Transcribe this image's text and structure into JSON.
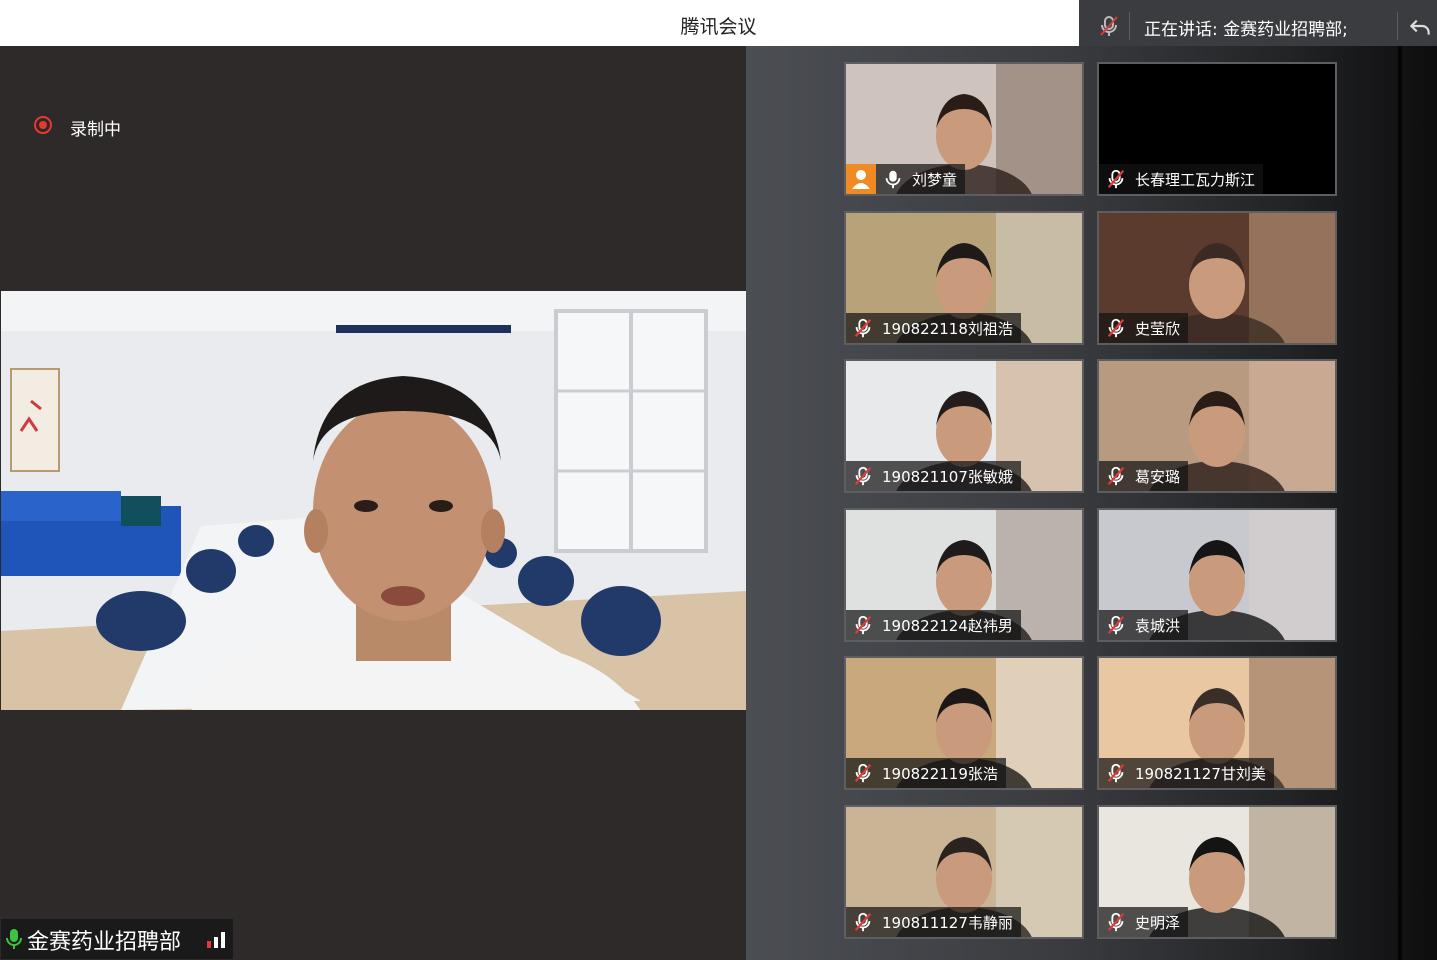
{
  "window": {
    "title": "腾讯会议"
  },
  "speaking": {
    "text": "正在讲话: 金赛药业招聘部;"
  },
  "recording": {
    "label": "录制中",
    "color": "#e8392e"
  },
  "main_speaker": {
    "name": "金赛药业招聘部"
  },
  "participants": [
    {
      "name": "刘梦童",
      "muted": false,
      "host_icon": true
    },
    {
      "name": "长春理工瓦力斯江",
      "muted": true,
      "video": false
    },
    {
      "name": "190822118刘祖浩",
      "muted": true
    },
    {
      "name": "史莹欣",
      "muted": true
    },
    {
      "name": "190821107张敏娥",
      "muted": true
    },
    {
      "name": "葛安璐",
      "muted": true
    },
    {
      "name": "190822124赵祎男",
      "muted": true
    },
    {
      "name": "袁城洪",
      "muted": true
    },
    {
      "name": "190822119张浩",
      "muted": true
    },
    {
      "name": "190821127甘刘美",
      "muted": true
    },
    {
      "name": "190811127韦静丽",
      "muted": true
    },
    {
      "name": "史明泽",
      "muted": true
    }
  ],
  "colors": {
    "accent_orange": "#f08a24",
    "mic_green": "#3cc43c",
    "muted_red": "#e03a3a"
  }
}
